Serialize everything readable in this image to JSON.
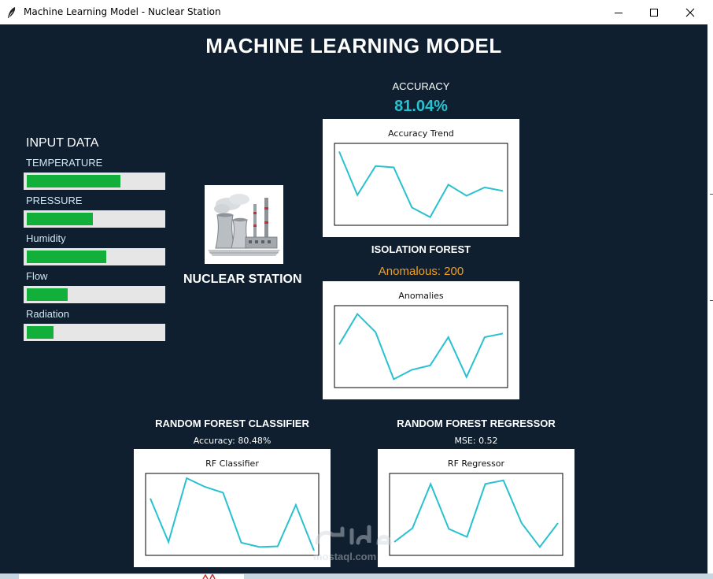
{
  "window": {
    "title": "Machine Learning Model - Nuclear Station"
  },
  "header": {
    "title": "MACHINE LEARNING MODEL"
  },
  "input_data": {
    "title": "INPUT DATA",
    "items": [
      {
        "label": "TEMPERATURE",
        "level": 0.69
      },
      {
        "label": "PRESSURE",
        "level": 0.49
      },
      {
        "label": "Humidity",
        "level": 0.59
      },
      {
        "label": "Flow",
        "level": 0.3
      },
      {
        "label": "Radiation",
        "level": 0.2
      }
    ]
  },
  "station": {
    "label": "NUCLEAR STATION"
  },
  "accuracy": {
    "label": "ACCURACY",
    "value": "81.04%"
  },
  "isolation_forest": {
    "title": "ISOLATION FOREST",
    "value": "Anomalous: 200"
  },
  "rf_classifier": {
    "title": "RANDOM FOREST CLASSIFIER",
    "value": "Accuracy: 80.48%"
  },
  "rf_regressor": {
    "title": "RANDOM FOREST REGRESSOR",
    "value": "MSE: 0.52"
  },
  "watermark": {
    "text": "mostaql.com"
  },
  "colors": {
    "background": "#0f1f2f",
    "line": "#29c1cf",
    "bar": "#12b03a",
    "accent": "#f0a020"
  },
  "chart_data": [
    {
      "id": "accuracy",
      "type": "line",
      "title": "Accuracy Trend",
      "x": [
        0,
        1,
        2,
        3,
        4,
        5,
        6,
        7,
        8,
        9
      ],
      "values": [
        1.0,
        0.37,
        0.79,
        0.77,
        0.19,
        0.05,
        0.52,
        0.36,
        0.48,
        0.43
      ],
      "ylim": [
        0,
        1.05
      ]
    },
    {
      "id": "anomalies",
      "type": "line",
      "title": "Anomalies",
      "x": [
        0,
        1,
        2,
        3,
        4,
        5,
        6,
        7,
        8,
        9
      ],
      "values": [
        0.53,
        0.95,
        0.7,
        0.05,
        0.18,
        0.24,
        0.63,
        0.08,
        0.63,
        0.68
      ],
      "ylim": [
        0,
        1.0
      ]
    },
    {
      "id": "rf_classifier",
      "type": "line",
      "title": "RF Classifier",
      "x": [
        0,
        1,
        2,
        3,
        4,
        5,
        6,
        7,
        8,
        9
      ],
      "values": [
        0.72,
        0.12,
        1.0,
        0.88,
        0.8,
        0.11,
        0.05,
        0.06,
        0.63,
        0.0
      ],
      "ylim": [
        0,
        1.0
      ]
    },
    {
      "id": "rf_regressor",
      "type": "line",
      "title": "RF Regressor",
      "x": [
        0,
        1,
        2,
        3,
        4,
        5,
        6,
        7,
        8,
        9
      ],
      "values": [
        0.12,
        0.31,
        0.92,
        0.3,
        0.19,
        0.92,
        0.97,
        0.38,
        0.05,
        0.38
      ],
      "ylim": [
        0,
        1.0
      ]
    }
  ]
}
